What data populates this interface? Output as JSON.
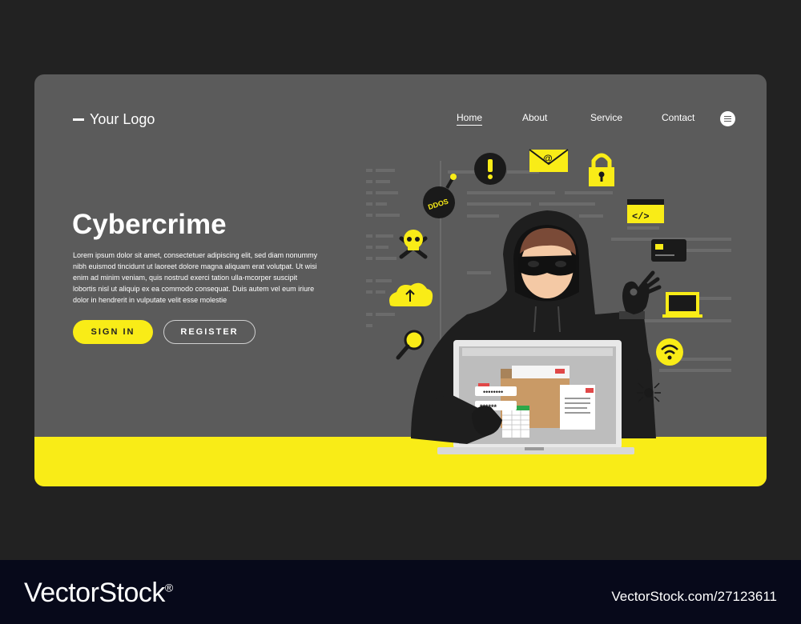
{
  "header": {
    "logo_text": "Your Logo",
    "nav": [
      {
        "label": "Home",
        "active": true
      },
      {
        "label": "About",
        "active": false
      },
      {
        "label": "Service",
        "active": false
      },
      {
        "label": "Contact",
        "active": false
      }
    ],
    "menu_icon": "hamburger-menu-icon"
  },
  "hero": {
    "title": "Cybercrime",
    "body": "Lorem ipsum dolor sit amet, consectetuer adipiscing elit, sed diam nonummy nibh euismod tincidunt ut laoreet dolore magna aliquam erat volutpat. Ut wisi enim ad minim veniam, quis nostrud exerci tation ulla-mcorper suscipit lobortis nisl ut aliquip ex ea commodo consequat. Duis autem vel eum iriure dolor in hendrerit in vulputate velit esse molestie",
    "primary_button": "SIGN IN",
    "secondary_button": "REGISTER"
  },
  "illustration": {
    "bomb_label": "DDOS",
    "password_mask": "••••••••",
    "password_stars": "******",
    "icons": [
      "alert-icon",
      "email-icon",
      "padlock-icon",
      "code-window-icon",
      "credit-card-icon",
      "laptop-icon",
      "wifi-icon",
      "spider-icon",
      "cloud-upload-icon",
      "skull-icon",
      "bomb-icon",
      "magnifier-icon"
    ]
  },
  "watermark": {
    "brand": "VectorStock",
    "registered": "®",
    "image_id": "VectorStock.com/27123611"
  },
  "colors": {
    "accent": "#f9ec17",
    "card": "#5b5b5b",
    "background": "#222222",
    "hacker": "#1e1e1e"
  }
}
